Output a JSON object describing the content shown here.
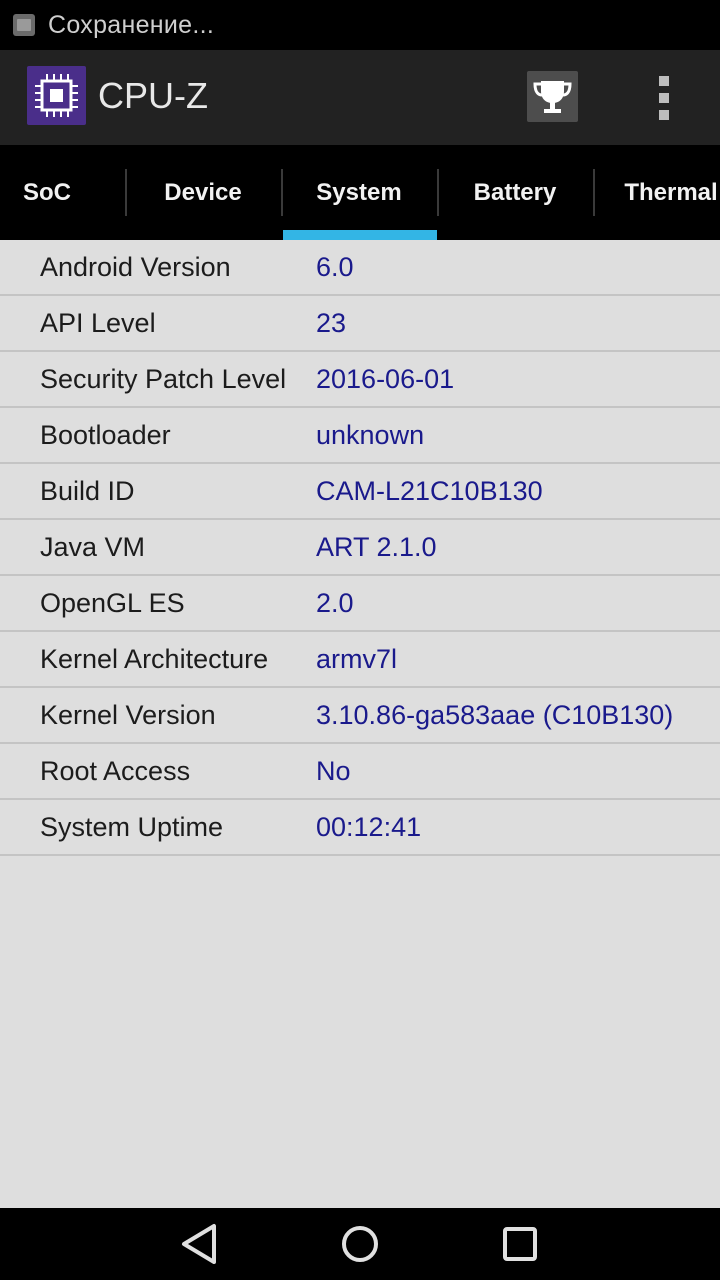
{
  "status_bar": {
    "notification_text": "Сохранение...",
    "icon": "gallery-icon"
  },
  "app_bar": {
    "title": "CPU-Z",
    "logo_icon": "cpu-chip-icon",
    "trophy_icon": "trophy-icon",
    "menu_icon": "overflow-menu-icon"
  },
  "tabs": [
    {
      "label": "SoC",
      "selected": false
    },
    {
      "label": "Device",
      "selected": false
    },
    {
      "label": "System",
      "selected": true
    },
    {
      "label": "Battery",
      "selected": false
    },
    {
      "label": "Thermal",
      "selected": false
    }
  ],
  "system_info": [
    {
      "label": "Android Version",
      "value": "6.0"
    },
    {
      "label": "API Level",
      "value": "23"
    },
    {
      "label": "Security Patch Level",
      "value": "2016-06-01"
    },
    {
      "label": "Bootloader",
      "value": "unknown"
    },
    {
      "label": "Build ID",
      "value": "CAM-L21C10B130"
    },
    {
      "label": "Java VM",
      "value": "ART 2.1.0"
    },
    {
      "label": "OpenGL ES",
      "value": "2.0"
    },
    {
      "label": "Kernel Architecture",
      "value": "armv7l"
    },
    {
      "label": "Kernel Version",
      "value": "3.10.86-ga583aae (C10B130)"
    },
    {
      "label": "Root Access",
      "value": "No"
    },
    {
      "label": "System Uptime",
      "value": "00:12:41"
    }
  ],
  "nav_bar": {
    "back_icon": "back-triangle-icon",
    "home_icon": "home-circle-icon",
    "recents_icon": "recents-square-icon"
  },
  "colors": {
    "accent": "#33b5e5",
    "value_text": "#1a1a8c",
    "logo_bg": "#4a2e8a"
  }
}
